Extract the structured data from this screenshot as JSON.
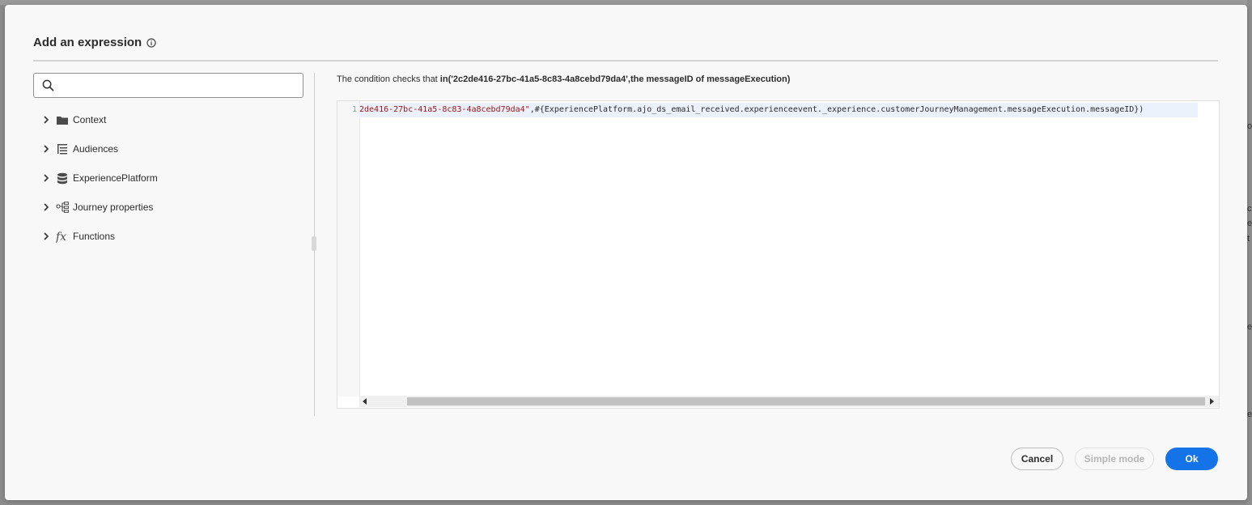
{
  "dialog": {
    "title": "Add an expression",
    "info_icon": "info-icon"
  },
  "search": {
    "placeholder": ""
  },
  "tree": [
    {
      "label": "Context",
      "icon": "folder-icon"
    },
    {
      "label": "Audiences",
      "icon": "audience-list-icon"
    },
    {
      "label": "ExperiencePlatform",
      "icon": "database-icon"
    },
    {
      "label": "Journey properties",
      "icon": "journey-properties-icon"
    },
    {
      "label": "Functions",
      "icon": "function-fx-icon"
    }
  ],
  "condition": {
    "prefix": "The condition checks that ",
    "expression": "in('2c2de416-27bc-41a5-8c83-4a8cebd79da4',the messageID of messageExecution)"
  },
  "editor": {
    "line_number": "1",
    "code_string": "2de416-27bc-41a5-8c83-4a8cebd79da4\"",
    "code_rest": ",#{ExperiencePlatform.ajo_ds_email_received.experienceevent._experience.customerJourneyManagement.messageExecution.messageID})"
  },
  "buttons": {
    "cancel": "Cancel",
    "simple_mode": "Simple mode",
    "ok": "Ok"
  },
  "background_fragments": [
    "o",
    "c",
    "e",
    "t",
    "e",
    "e"
  ],
  "colors": {
    "accent": "#1473e6",
    "string": "#a31515"
  }
}
